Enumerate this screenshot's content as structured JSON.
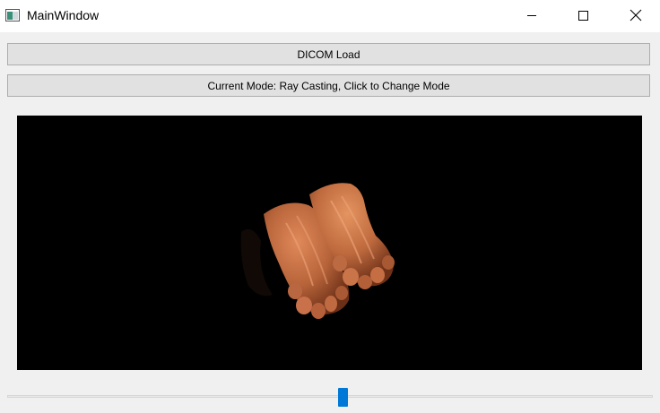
{
  "window": {
    "title": "MainWindow"
  },
  "buttons": {
    "dicom_load": "DICOM Load",
    "mode": "Current Mode: Ray Casting, Click to Change Mode"
  },
  "render_view": {
    "background": "#000000",
    "content": "feet-volume-render",
    "tissue_color": "#b8643a"
  },
  "slider": {
    "value_fraction": 0.52,
    "accent": "#0078d7"
  },
  "colors": {
    "window_bg": "#f0f0f0",
    "titlebar_bg": "#ffffff",
    "button_bg": "#e1e1e1"
  }
}
